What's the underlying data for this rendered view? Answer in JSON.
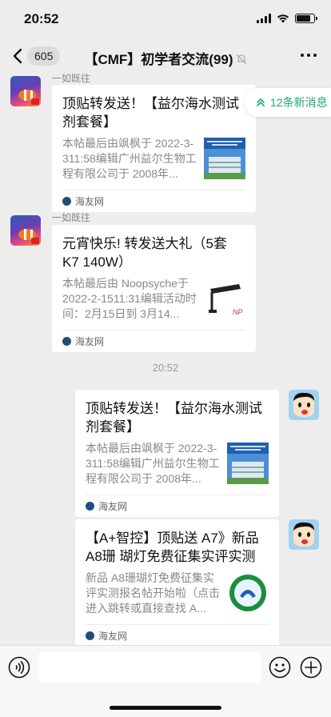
{
  "status": {
    "time": "20:52"
  },
  "nav": {
    "badge": "605",
    "title": "【CMF】初学者交流(99)"
  },
  "new_messages": {
    "label": "12条新消息"
  },
  "messages": [
    {
      "sender": "一如既往",
      "title": "顶贴转发送！【益尔海水测试剂套餐】",
      "desc": "本帖最后由飒枫于 2022-3-311:58编辑广州益尔生物工程有限公司于 2008年...",
      "source": "海友网",
      "thumb": "building"
    },
    {
      "sender": "一如既往",
      "title": "元宵快乐! 转发送大礼（5套 K7  140W）",
      "desc": "本帖最后由 Noopsyche于 2022-2-1511:31编辑活动时间：2月15日到 3月14...",
      "source": "海友网",
      "thumb": "lamp"
    },
    {
      "title": "顶贴转发送！【益尔海水测试剂套餐】",
      "desc": "本帖最后由飒枫于 2022-3-311:58编辑广州益尔生物工程有限公司于 2008年...",
      "source": "海友网",
      "thumb": "building"
    },
    {
      "title": "【A+智控】顶贴送 A7》新品 A8珊 瑚灯免费征集实评实测",
      "desc": "新品 A8珊瑚灯免费征集实评实测报名帖开始啦（点击进入跳转或直接查找 A...",
      "source": "海友网",
      "thumb": "logo"
    }
  ],
  "time_separator": "20:52",
  "colors": {
    "background": "#ededed",
    "accent": "#21a675",
    "card": "#ffffff"
  },
  "icons": [
    "back-icon",
    "mute-icon",
    "more-icon",
    "voice-icon",
    "emoji-icon",
    "plus-icon"
  ]
}
